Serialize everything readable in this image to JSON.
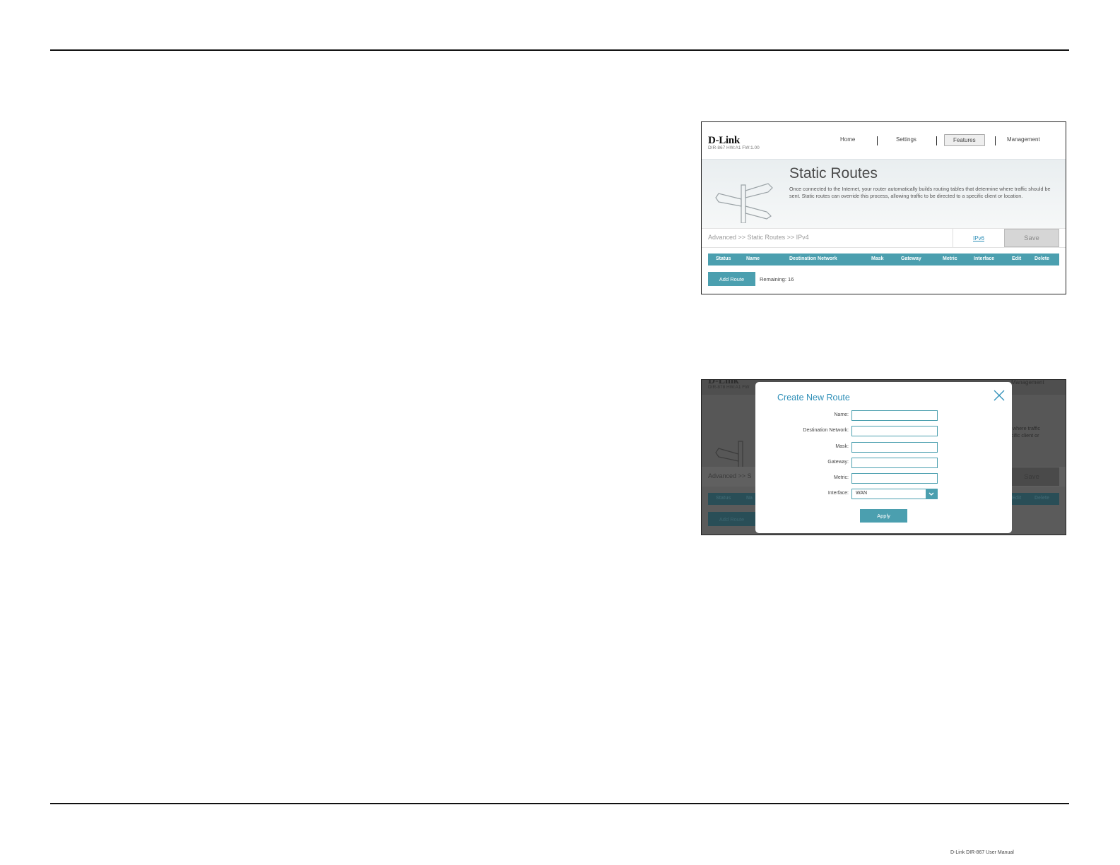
{
  "shot1": {
    "brand": "D-Link",
    "model": "DIR-867 HW:A1 FW:1.00",
    "nav": [
      "Home",
      "Settings",
      "Features",
      "Management"
    ],
    "title": "Static Routes",
    "description": "Once connected to the Internet, your router automatically builds routing tables that determine where traffic should be sent. Static routes can override this process, allowing traffic to be directed to a specific client or location.",
    "breadcrumb": "Advanced >> Static Routes >> IPv4",
    "ipv6_link": "IPv6",
    "save_label": "Save",
    "table_headers": [
      "Status",
      "Name",
      "Destination Network",
      "Mask",
      "Gateway",
      "Metric",
      "Interface",
      "Edit",
      "Delete"
    ],
    "add_route_label": "Add Route",
    "remaining_text": "Remaining: 16"
  },
  "shot2": {
    "background": {
      "brand": "D-Link",
      "model": "DIR-878 HW:A1 FW",
      "nav_visible": "Management",
      "desc_fragment_1": "e where traffic",
      "desc_fragment_2": "ecific client or",
      "breadcrumb_fragment": "Advanced >> S",
      "save_label": "Save",
      "table_headers_left": [
        "Status",
        "Na"
      ],
      "table_headers_right": [
        "Edit",
        "Delete"
      ],
      "add_route_label": "Add Route"
    },
    "modal": {
      "title": "Create New Route",
      "fields": [
        "Name:",
        "Destination Network:",
        "Mask:",
        "Gateway:",
        "Metric:",
        "Interface:"
      ],
      "interface_value": "WAN",
      "apply_label": "Apply"
    }
  },
  "footer_note": "D-Link DIR-867 User Manual"
}
